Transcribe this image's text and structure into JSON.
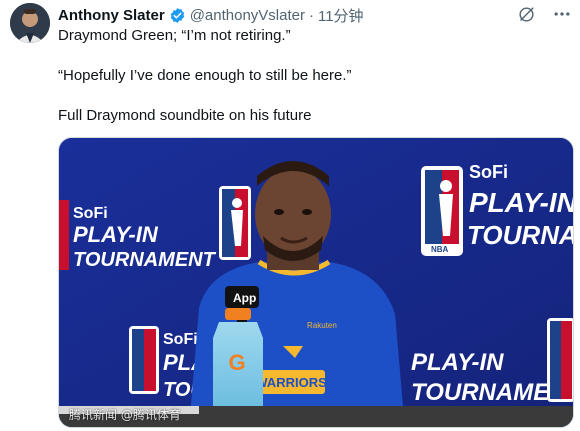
{
  "author": {
    "name": "Anthony Slater",
    "handle": "@anthonyVslater",
    "separator": "·",
    "time": "11分钟"
  },
  "tweet": {
    "line1": "Draymond Green; “I’m not retiring.”",
    "line2": "“Hopefully I’ve done enough to still be here.”",
    "line3": "Full Draymond soundbite on his future"
  },
  "media": {
    "backdrop_brand_top": "SoFi",
    "backdrop_title_1": "PLAY-IN",
    "backdrop_title_2": "TOURNAMENT",
    "nba_logo_text": "NBA",
    "mic_label": "App",
    "bottle_brand": "G",
    "jersey_text": "WARRIORS",
    "jersey_brand": "Rakuten",
    "watermark": "腾讯新闻 @腾讯体育"
  },
  "icons": {
    "verified": "verified-badge-icon",
    "grok": "grok-icon",
    "more": "more-icon"
  },
  "colors": {
    "verified": "#1d9bf0",
    "backdrop": "#1d2c8a",
    "nba_red": "#c8102e",
    "jersey": "#1d4fc7",
    "gold": "#f5b82e"
  }
}
